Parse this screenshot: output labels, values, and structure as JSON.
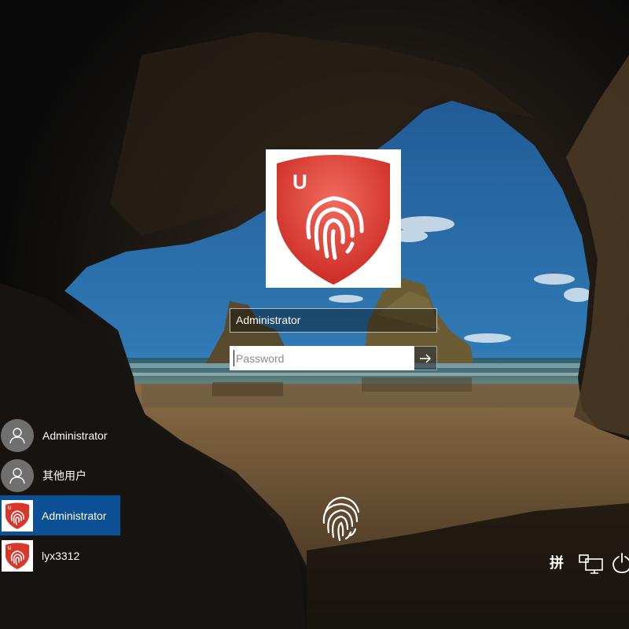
{
  "login": {
    "username_value": "Administrator",
    "password_placeholder": "Password"
  },
  "users": [
    {
      "name": "Administrator",
      "avatar": "person-icon",
      "selected": false
    },
    {
      "name": "其他用户",
      "avatar": "person-icon",
      "selected": false
    },
    {
      "name": "Administrator",
      "avatar": "fingerprint-shield-logo",
      "selected": true
    },
    {
      "name": "lyx3312",
      "avatar": "fingerprint-shield-logo",
      "selected": false
    }
  ],
  "logo": {
    "letter": "U"
  },
  "system_tray": {
    "ime_label": "拼"
  },
  "icons": {
    "submit": "arrow-right-icon",
    "fingerprint": "fingerprint-icon",
    "network": "network-icon",
    "power": "power-icon"
  },
  "colors": {
    "brand_red": "#d9372c",
    "selected_user_bg": "#0b4f94",
    "generic_avatar": "#6f6f6f"
  }
}
